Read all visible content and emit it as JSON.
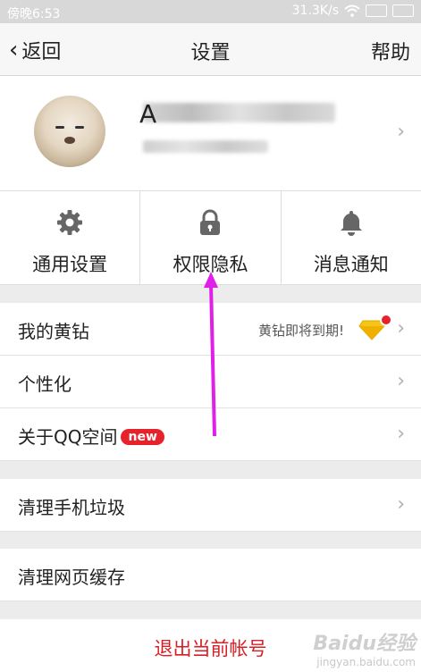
{
  "status_bar": {
    "time": "傍晚6:53",
    "speed": "31.3K/s"
  },
  "nav": {
    "back_label": "返回",
    "title": "设置",
    "help_label": "帮助"
  },
  "profile": {
    "name_initial": "A"
  },
  "tabs": [
    {
      "label": "通用设置",
      "icon": "gear-icon"
    },
    {
      "label": "权限隐私",
      "icon": "lock-icon"
    },
    {
      "label": "消息通知",
      "icon": "bell-icon"
    }
  ],
  "list": {
    "yellow_diamond": {
      "label": "我的黄钻",
      "hint": "黄钻即将到期!"
    },
    "personalize": {
      "label": "个性化"
    },
    "about": {
      "label": "关于QQ空间",
      "badge": "new"
    },
    "clean_junk": {
      "label": "清理手机垃圾"
    },
    "clean_cache": {
      "label": "清理网页缓存"
    }
  },
  "logout": {
    "label": "退出当前帐号"
  },
  "watermark": {
    "logo": "Baidu经验",
    "url": "jingyan.baidu.com"
  },
  "colors": {
    "accent_red": "#d61f26",
    "annotation_arrow": "#e020e8"
  }
}
